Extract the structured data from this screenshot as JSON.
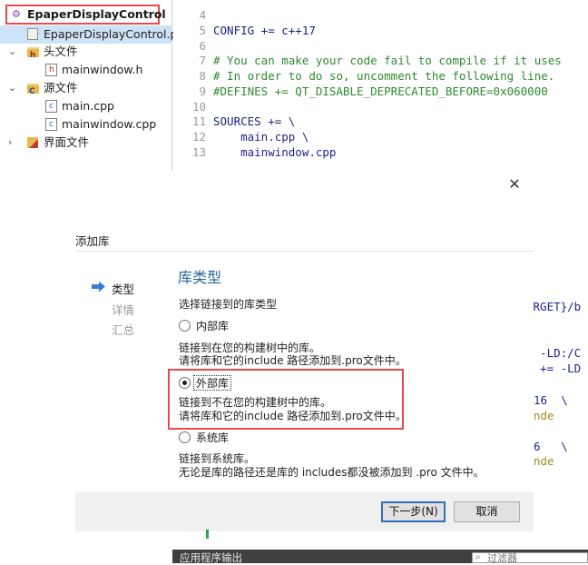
{
  "project_tree": {
    "root": "EpaperDisplayControl",
    "items": [
      {
        "label": "EpaperDisplayControl.pro",
        "display": "EpaperDisplayControl.pı"
      },
      {
        "label": "头文件"
      },
      {
        "label": "mainwindow.h"
      },
      {
        "label": "源文件"
      },
      {
        "label": "main.cpp"
      },
      {
        "label": "mainwindow.cpp"
      },
      {
        "label": "界面文件"
      }
    ]
  },
  "editor": {
    "lines": [
      {
        "n": "4",
        "text": ""
      },
      {
        "n": "5",
        "text": "CONFIG += c++17"
      },
      {
        "n": "6",
        "text": ""
      },
      {
        "n": "7",
        "text": "# You can make your code fail to compile if it uses"
      },
      {
        "n": "8",
        "text": "# In order to do so, uncomment the following line."
      },
      {
        "n": "9",
        "text": "#DEFINES += QT_DISABLE_DEPRECATED_BEFORE=0x060000"
      },
      {
        "n": "10",
        "text": ""
      },
      {
        "n": "11",
        "text": "SOURCES += \\"
      },
      {
        "n": "12",
        "text": "    main.cpp \\"
      },
      {
        "n": "13",
        "text": "    mainwindow.cpp"
      }
    ],
    "bleed": [
      "ARGET}/b",
      "= -LD:/C",
      "S += -LD",
      "16  \\",
      "nde",
      "6   \\",
      "nde"
    ]
  },
  "dialog": {
    "close_icon": "✕",
    "title": "添加库",
    "steps": [
      "类型",
      "详情",
      "汇总"
    ],
    "heading": "库类型",
    "subtitle": "选择链接到的库类型",
    "options": [
      {
        "label": "内部库",
        "checked": false,
        "desc": [
          "链接到在您的构建树中的库。",
          "请将库和它的include 路径添加到.pro文件中。"
        ]
      },
      {
        "label": "外部库",
        "checked": true,
        "desc": [
          "链接到不在您的构建树中的库。",
          "请将库和它的include 路径添加到.pro文件中。"
        ]
      },
      {
        "label": "系统库",
        "checked": false,
        "desc": [
          "链接到系统库。",
          "无论是库的路径还是库的 includes都没被添加到 .pro 文件中。"
        ]
      }
    ],
    "next_button": "下一步(N)",
    "cancel_button": "取消"
  },
  "bottom": {
    "output_label": "应用程序输出",
    "filter_placeholder": "过滤器"
  },
  "colors": {
    "highlight": "#e74c4c",
    "heading": "#2a6496",
    "default_button_border": "#2e6fbd"
  }
}
